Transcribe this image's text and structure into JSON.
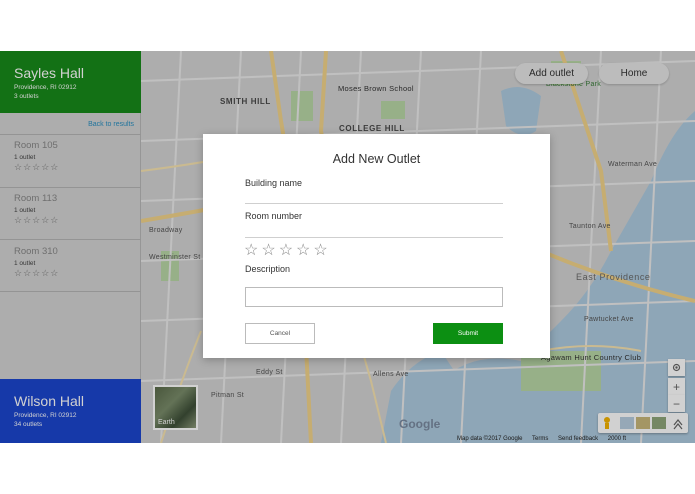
{
  "sidebar": {
    "top_hall": {
      "name": "Sayles Hall",
      "address": "Providence, RI 02912",
      "outlets": "3 outlets"
    },
    "back_link": "Back to results",
    "rooms": [
      {
        "name": "Room 105",
        "outlets": "1 outlet",
        "stars": "☆☆☆☆☆",
        "rating": 0
      },
      {
        "name": "Room 113",
        "outlets": "1 outlet",
        "stars": "☆☆☆☆☆",
        "rating": 0
      },
      {
        "name": "Room 310",
        "outlets": "1 outlet",
        "stars": "☆☆☆☆☆",
        "rating": 0
      }
    ],
    "bottom_hall": {
      "name": "Wilson Hall",
      "address": "Providence, RI 02912",
      "outlets": "34 outlets"
    }
  },
  "map": {
    "add_outlet_label": "Add outlet",
    "home_label": "Home",
    "labels": {
      "smith_hill": "SMITH HILL",
      "college_hill": "COLLEGE HILL",
      "moses_brown": "Moses Brown School",
      "lippitt": "Lippitt Park",
      "blackstone": "Blackstone Park",
      "taunton": "Taunton Ave",
      "east_providence": "East Providence",
      "country_club": "Agawam Hunt Country Club",
      "pawtucket": "Pawtucket Ave",
      "broadway": "Broadway",
      "westminster": "Westminster St",
      "pitman": "Pitman St",
      "waterman": "Waterman Ave",
      "allens": "Allens Ave",
      "eddy": "Eddy St"
    },
    "earth_label": "Earth",
    "google_logo": "Google",
    "footer": {
      "map_data": "Map data ©2017 Google",
      "terms": "Terms",
      "feedback": "Send feedback",
      "scale": "2000 ft"
    },
    "zoom_in": "+",
    "zoom_out": "−",
    "locate_icon": "target-icon"
  },
  "modal": {
    "title": "Add New Outlet",
    "building_label": "Building name",
    "room_label": "Room number",
    "rating_stars": "☆☆☆☆☆",
    "description_label": "Description",
    "description_value": "",
    "cancel_label": "Cancel",
    "submit_label": "Submit"
  },
  "colors": {
    "sayles_green": "#188a1a",
    "wilson_blue": "#1b46cf",
    "submit_green": "#0c8f12",
    "link_blue": "#2a8fc0"
  }
}
